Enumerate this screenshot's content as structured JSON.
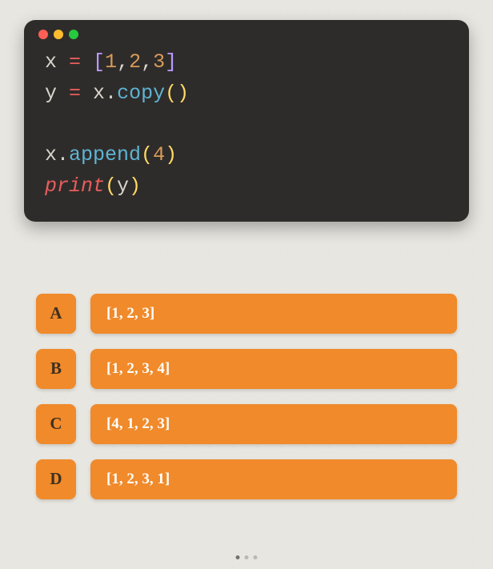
{
  "code": {
    "line1": {
      "v": "x ",
      "op": "= ",
      "lb": "[",
      "n1": "1",
      "c1": ",",
      "n2": "2",
      "c2": ",",
      "n3": "3",
      "rb": "]"
    },
    "line2": {
      "v": "y ",
      "op": "= ",
      "obj": "x",
      "dot": ".",
      "method": "copy",
      "lp": "(",
      "rp": ")"
    },
    "line3_blank": "",
    "line4": {
      "obj": "x",
      "dot": ".",
      "method": "append",
      "lp": "(",
      "arg": "4",
      "rp": ")"
    },
    "line5": {
      "kw": "print",
      "lp": "(",
      "arg": "y",
      "rp": ")"
    }
  },
  "answers": [
    {
      "letter": "A",
      "text": "[1, 2, 3]"
    },
    {
      "letter": "B",
      "text": "[1, 2, 3, 4]"
    },
    {
      "letter": "C",
      "text": "[4, 1, 2, 3]"
    },
    {
      "letter": "D",
      "text": "[1, 2, 3, 1]"
    }
  ]
}
